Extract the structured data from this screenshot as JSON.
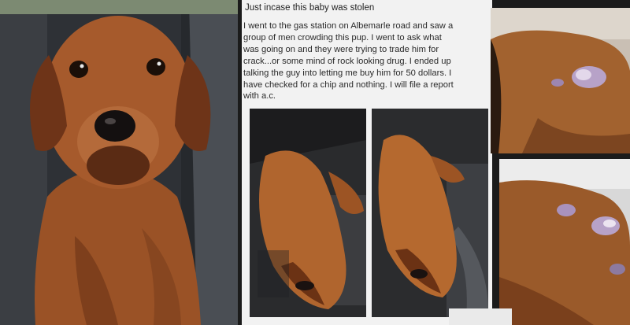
{
  "post": {
    "headline": "Just incase this baby was stolen",
    "story_lines": [
      "I went to the gas station on Albemarle road and saw a",
      "group of men crowding this pup. I went to ask what",
      "was going on and they were trying to trade him for",
      "crack...or some mind of rock looking drug. I ended up",
      "talking the guy into letting me buy him for 50 dollars. I",
      "have checked for a chip and nothing. I will file a report",
      "with a.c."
    ]
  },
  "colors": {
    "fur": "#a0552a",
    "fur_dark": "#5a2b14",
    "car_interior": "#3a3d42",
    "post_bg": "#f2f2f2",
    "wound": "#b7a2c8"
  }
}
